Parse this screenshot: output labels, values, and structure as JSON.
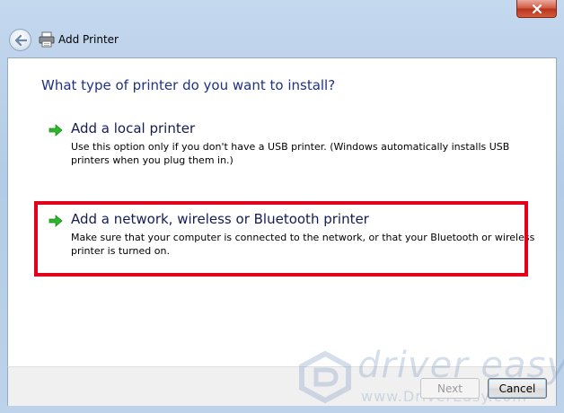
{
  "window": {
    "title": "Add Printer",
    "close_label": "✕"
  },
  "content": {
    "heading": "What type of printer do you want to install?",
    "options": [
      {
        "title": "Add a local printer",
        "description": "Use this option only if you don't have a USB printer. (Windows automatically installs USB printers when you plug them in.)",
        "icon": "green-arrow-icon"
      },
      {
        "title": "Add a network, wireless or Bluetooth printer",
        "description": "Make sure that your computer is connected to the network, or that your Bluetooth or wireless printer is turned on.",
        "icon": "green-arrow-icon",
        "highlighted": true
      }
    ]
  },
  "footer": {
    "next_label": "Next",
    "next_enabled": false,
    "cancel_label": "Cancel"
  },
  "watermark": {
    "brand": "driver easy",
    "url": "www.DriverEasy.com"
  },
  "colors": {
    "heading": "#1e3287",
    "option_title": "#151c55",
    "highlight": "#e3001b",
    "arrow": "#2db52d",
    "close_button": "#c94a30"
  }
}
